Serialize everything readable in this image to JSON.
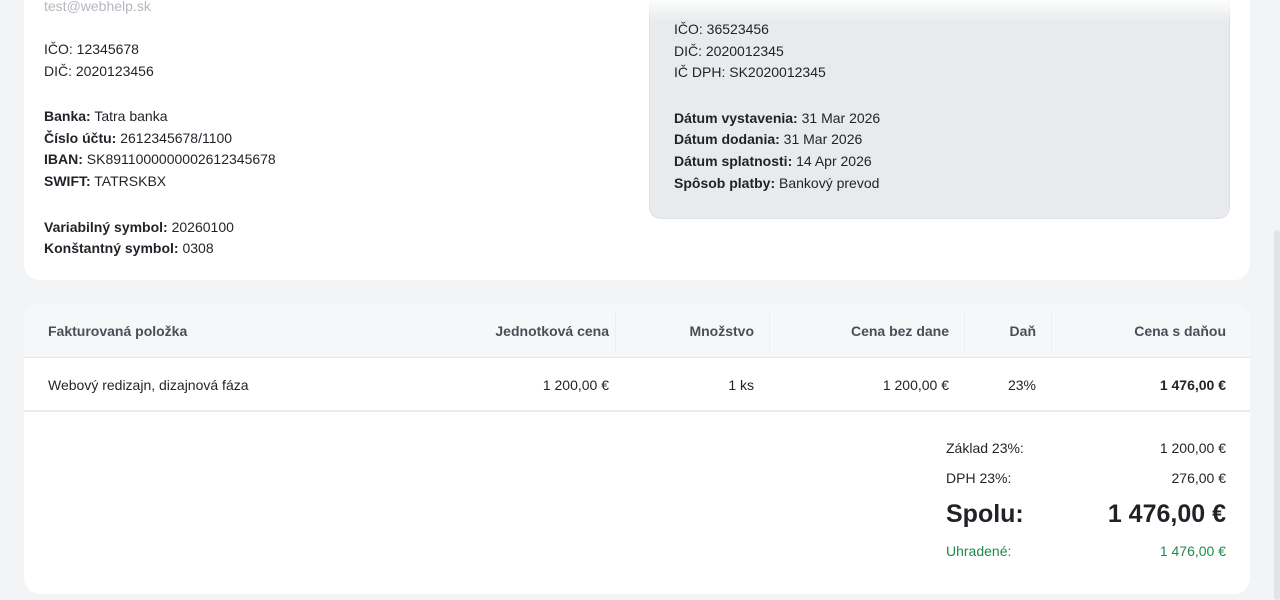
{
  "issuer": {
    "email": "test@webhelp.sk",
    "ico_label": "IČO:",
    "ico": "12345678",
    "dic_label": "DIČ:",
    "dic": "2020123456",
    "bank_label": "Banka:",
    "bank": "Tatra banka",
    "account_label": "Číslo účtu:",
    "account": "2612345678/1100",
    "iban_label": "IBAN:",
    "iban": "SK8911000000002612345678",
    "swift_label": "SWIFT:",
    "swift": "TATRSKBX",
    "vs_label": "Variabilný symbol:",
    "vs": "20260100",
    "ks_label": "Konštantný symbol:",
    "ks": "0308"
  },
  "buyer": {
    "ico_label": "IČO:",
    "ico": "36523456",
    "dic_label": "DIČ:",
    "dic": "2020012345",
    "icdph_label": "IČ DPH:",
    "icdph": "SK2020012345",
    "issue_label": "Dátum vystavenia:",
    "issue": "31 Mar 2026",
    "delivery_label": "Dátum dodania:",
    "delivery": "31 Mar 2026",
    "due_label": "Dátum splatnosti:",
    "due": "14 Apr 2026",
    "payment_label": "Spôsob platby:",
    "payment": "Bankový prevod"
  },
  "table": {
    "headers": [
      "Fakturovaná položka",
      "Jednotková cena",
      "Množstvo",
      "Cena bez dane",
      "Daň",
      "Cena s daňou"
    ],
    "rows": [
      [
        "Webový redizajn, dizajnová fáza",
        "1 200,00 €",
        "1 ks",
        "1 200,00 €",
        "23%",
        "1 476,00 €"
      ]
    ]
  },
  "totals": {
    "base_label": "Základ 23%:",
    "base": "1 200,00 €",
    "vat_label": "DPH 23%:",
    "vat": "276,00 €",
    "total_label": "Spolu:",
    "total": "1 476,00 €",
    "paid_label": "Uhradené:",
    "paid": "1 476,00 €"
  },
  "colors": {
    "paid": "#1f8a4c",
    "buyer_box": "#e8eaed",
    "background": "#f3f4f6"
  }
}
